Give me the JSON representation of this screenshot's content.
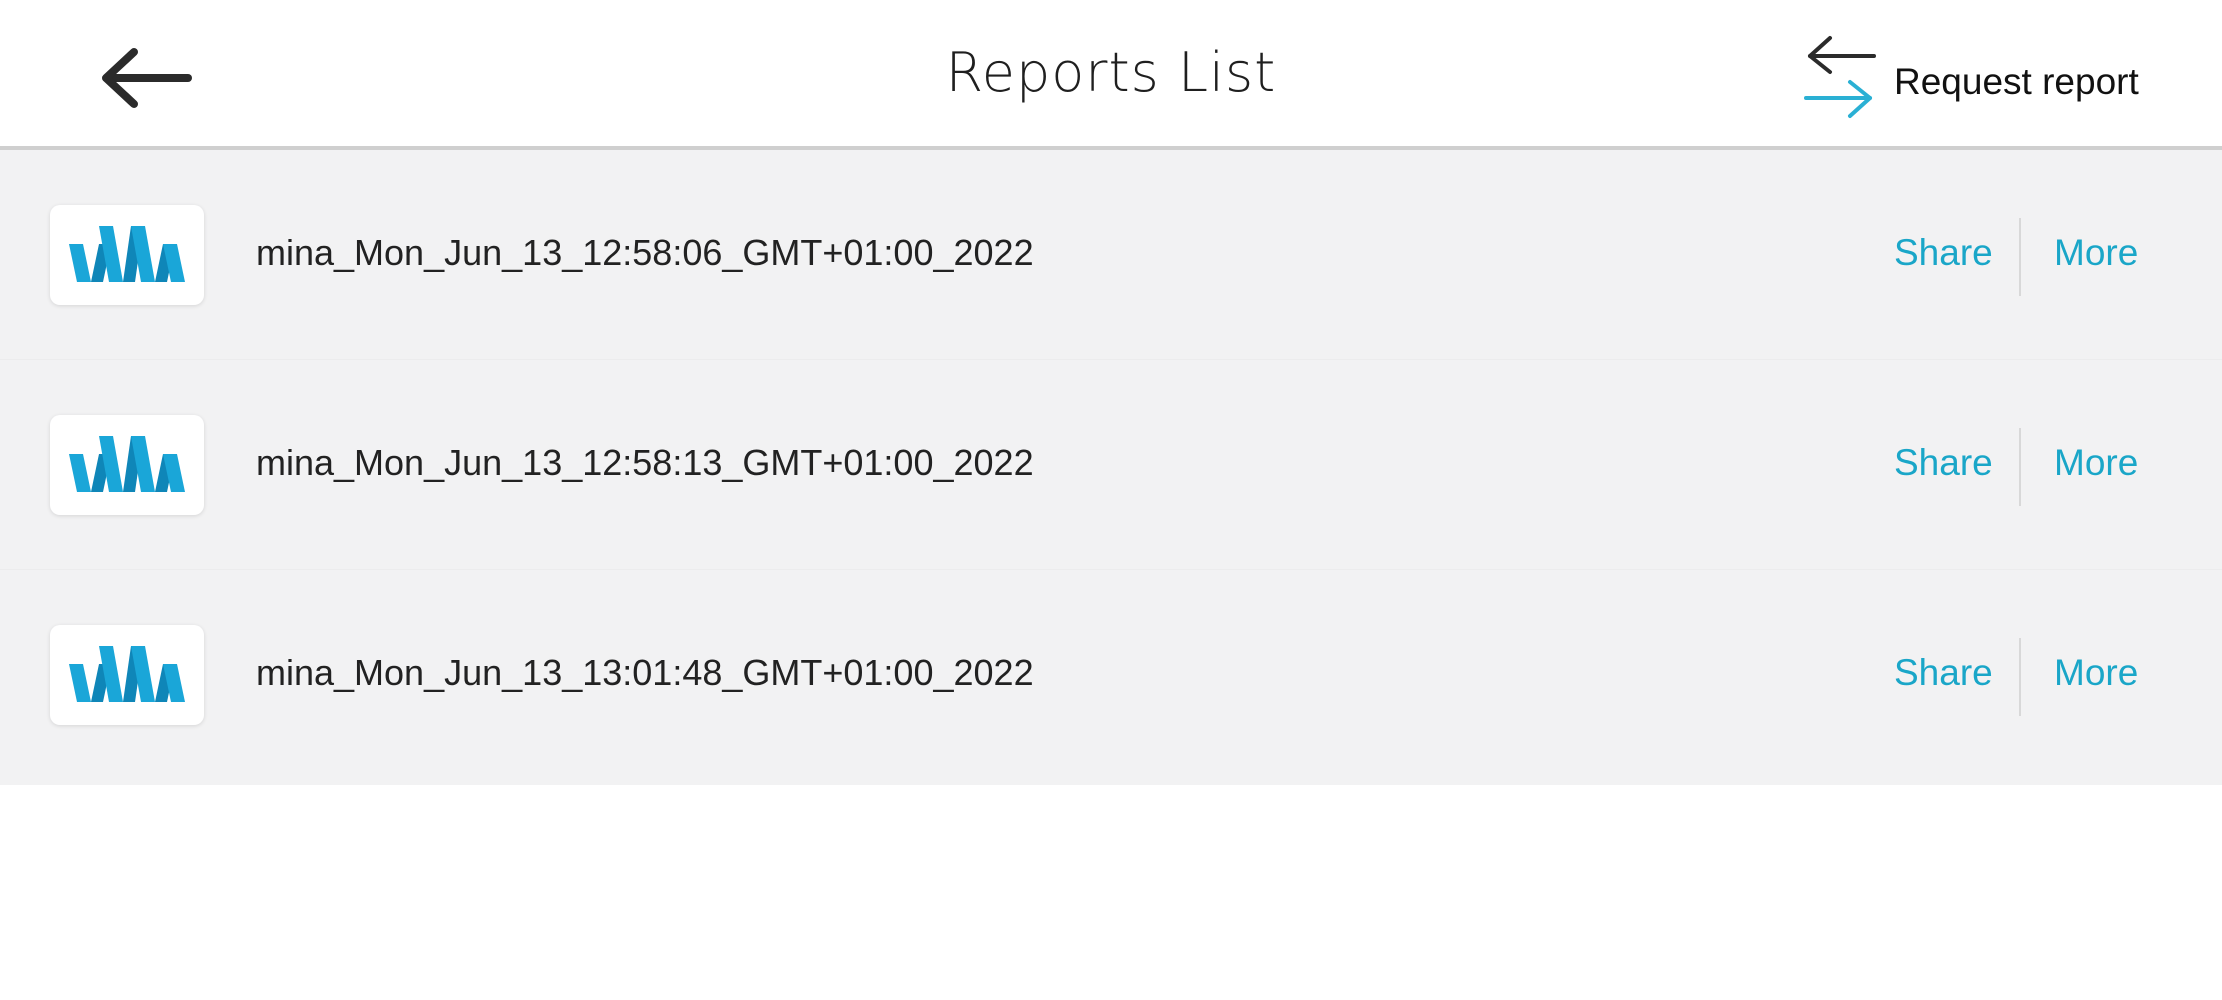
{
  "header": {
    "title": "Reports List",
    "back_icon": "arrow-left-icon",
    "request_icon": "swap-arrows-icon",
    "request_label": "Request report"
  },
  "colors": {
    "accent": "#1aa6c8",
    "list_background": "#f2f2f3",
    "logo_blue": "#1aa6d8"
  },
  "reports": [
    {
      "name": "mina_Mon_Jun_13_12:58:06_GMT+01:00_2022",
      "share_label": "Share",
      "more_label": "More",
      "icon": "app-logo-icon"
    },
    {
      "name": "mina_Mon_Jun_13_12:58:13_GMT+01:00_2022",
      "share_label": "Share",
      "more_label": "More",
      "icon": "app-logo-icon"
    },
    {
      "name": "mina_Mon_Jun_13_13:01:48_GMT+01:00_2022",
      "share_label": "Share",
      "more_label": "More",
      "icon": "app-logo-icon"
    }
  ]
}
